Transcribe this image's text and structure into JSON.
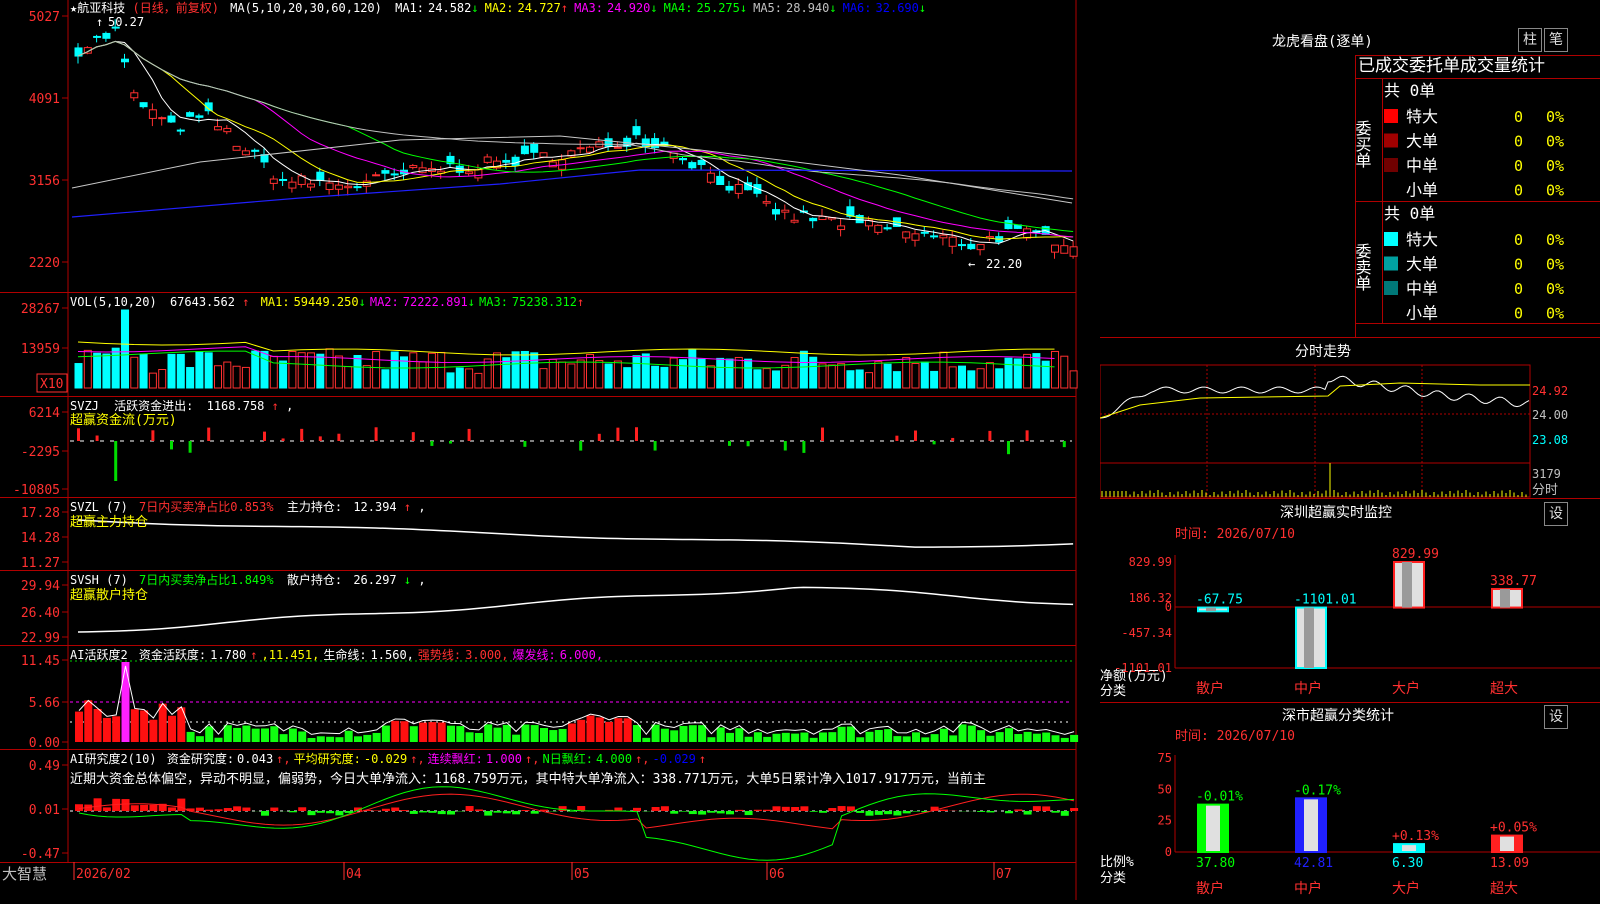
{
  "header": {
    "stock_name": "★航亚科技",
    "mode": "(日线，前复权)",
    "ma_params": "MA(5,10,20,30,60,120)",
    "ma": [
      {
        "label": "MA1:",
        "value": "24.582",
        "arrow": "↓",
        "color": "#ffffff"
      },
      {
        "label": "MA2:",
        "value": "24.727",
        "arrow": "↑",
        "color": "#ffff00"
      },
      {
        "label": "MA3:",
        "value": "24.920",
        "arrow": "↓",
        "color": "#ff00ff"
      },
      {
        "label": "MA4:",
        "value": "25.275",
        "arrow": "↓",
        "color": "#00ff00"
      },
      {
        "label": "MA5:",
        "value": "28.940",
        "arrow": "↓",
        "color": "#c0c0c0"
      },
      {
        "label": "MA6:",
        "value": "32.690",
        "arrow": "↓",
        "color": "#0000ff"
      }
    ]
  },
  "price_axis": [
    "5027",
    "4091",
    "3156",
    "2220"
  ],
  "price_marks": {
    "high": "50.27",
    "low": "22.20"
  },
  "vol_panel": {
    "title": "VOL(5,10,20)",
    "value": "67643.562",
    "value_arrow": "↑",
    "ma": [
      {
        "label": "MA1:",
        "value": "59449.250",
        "arrow": "↓",
        "color": "#ffff00"
      },
      {
        "label": "MA2:",
        "value": "72222.891",
        "arrow": "↓",
        "color": "#ff00ff"
      },
      {
        "label": "MA3:",
        "value": "75238.312",
        "arrow": "↑",
        "color": "#00ff00"
      }
    ],
    "axis": [
      "28267",
      "13959"
    ],
    "unit": "X10"
  },
  "svzj_panel": {
    "title": "SVZJ",
    "label": "活跃资金进出:",
    "value": "1168.758",
    "arrow": "↑",
    "suffix": ",",
    "subtitle": "超赢资金流(万元)",
    "axis": [
      "6214",
      "-2295",
      "-10805"
    ]
  },
  "svzl_panel": {
    "title": "SVZL (7)",
    "pct_label": "7日内买卖净占比0.853%",
    "hold_label": "主力持仓:",
    "hold_value": "12.394",
    "arrow": "↑",
    "suffix": ",",
    "subtitle": "超赢主力持仓",
    "axis": [
      "17.28",
      "14.28",
      "11.27"
    ]
  },
  "svsh_panel": {
    "title": "SVSH (7)",
    "pct_label": "7日内买卖净占比1.849%",
    "hold_label": "散户持仓:",
    "hold_value": "26.297",
    "arrow": "↓",
    "suffix": ",",
    "subtitle": "超赢散户持仓",
    "axis": [
      "29.94",
      "26.40",
      "22.99"
    ]
  },
  "ai2_panel": {
    "title": "AI活跃度2",
    "items": [
      {
        "text": "资金活跃度:",
        "color": "#ffffff"
      },
      {
        "text": "1.780",
        "color": "#ffffff"
      },
      {
        "text": "↑",
        "color": "#ff3030"
      },
      {
        "text": ",11.451,",
        "color": "#ffff00"
      },
      {
        "text": "生命线:",
        "color": "#ffffff"
      },
      {
        "text": "1.560,",
        "color": "#ffffff"
      },
      {
        "text": "强势线:",
        "color": "#ff3030"
      },
      {
        "text": "3.000,",
        "color": "#ff3030"
      },
      {
        "text": "爆发线:",
        "color": "#ff00ff"
      },
      {
        "text": "6.000,",
        "color": "#ff00ff"
      }
    ],
    "axis": [
      "11.45",
      "5.66",
      "0.00"
    ]
  },
  "ai_research_panel": {
    "title": "AI研究度2(10)",
    "items": [
      {
        "text": "资金研究度:",
        "color": "#ffffff"
      },
      {
        "text": "0.043",
        "color": "#ffffff"
      },
      {
        "text": "↑,",
        "color": "#ff3030"
      },
      {
        "text": "平均研究度:",
        "color": "#ffff00"
      },
      {
        "text": "-0.029",
        "color": "#ffff00"
      },
      {
        "text": "↑,",
        "color": "#ff3030"
      },
      {
        "text": "连续飘红:",
        "color": "#ff00ff"
      },
      {
        "text": "1.000",
        "color": "#ff00ff"
      },
      {
        "text": "↑,",
        "color": "#ff3030"
      },
      {
        "text": "N日飘红:",
        "color": "#00ff00"
      },
      {
        "text": "4.000",
        "color": "#00ff00"
      },
      {
        "text": "↑,",
        "color": "#ff3030"
      },
      {
        "text": "-0.029",
        "color": "#0000ff"
      },
      {
        "text": "↑",
        "color": "#ff3030"
      }
    ],
    "commentary": "近期大资金总体偏空，异动不明显，偏弱势，今日大单净流入：1168.759万元，其中特大单净流入：338.771万元，大单5日累计净入1017.917万元，当前主",
    "axis": [
      "0.49",
      "0.01",
      "-0.47"
    ]
  },
  "time_axis": {
    "brand": "大智慧",
    "labels": [
      "2026/02",
      "04",
      "05",
      "06",
      "07"
    ]
  },
  "dragon": {
    "title": "龙虎看盘(逐单)",
    "btn_bar": "柱",
    "btn_stroke": "笔",
    "subtitle": "已成交委托单成交量统计",
    "buy": {
      "label": "委买单",
      "total": "共 0单",
      "rows": [
        {
          "name": "特大",
          "count": "0",
          "pct": "0%",
          "color": "#ff0000"
        },
        {
          "name": "大单",
          "count": "0",
          "pct": "0%",
          "color": "#a00000"
        },
        {
          "name": "中单",
          "count": "0",
          "pct": "0%",
          "color": "#700000"
        },
        {
          "name": "小单",
          "count": "0",
          "pct": "0%",
          "color": ""
        }
      ]
    },
    "sell": {
      "label": "委卖单",
      "total": "共 0单",
      "rows": [
        {
          "name": "特大",
          "count": "0",
          "pct": "0%",
          "color": "#00ffff"
        },
        {
          "name": "大单",
          "count": "0",
          "pct": "0%",
          "color": "#00a0a0"
        },
        {
          "name": "中单",
          "count": "0",
          "pct": "0%",
          "color": "#007878"
        },
        {
          "name": "小单",
          "count": "0",
          "pct": "0%",
          "color": ""
        }
      ]
    }
  },
  "intraday": {
    "title": "分时走势",
    "price_axis": [
      "24.92",
      "24.00",
      "23.08"
    ],
    "vol_axis": "3179",
    "vol_label": "分时"
  },
  "sz_monitor": {
    "title": "深圳超赢实时监控",
    "btn": "设",
    "time": "时间: 2026/07/10",
    "axis": [
      "829.99",
      "186.32",
      "0",
      "-457.34",
      "-1101.01"
    ],
    "ylabel": "净额(万元)",
    "xlabel": "分类",
    "categories": [
      "散户",
      "中户",
      "大户",
      "超大"
    ],
    "value_labels": [
      "-67.75",
      "-1101.01",
      "829.99",
      "338.77"
    ]
  },
  "sz_class": {
    "title": "深市超赢分类统计",
    "btn": "设",
    "time": "时间: 2026/07/10",
    "axis": [
      "75",
      "50",
      "25",
      "0"
    ],
    "ylabel": "比例%",
    "xlabel": "分类",
    "categories": [
      "散户",
      "中户",
      "大户",
      "超大"
    ],
    "change_labels": [
      "-0.01%",
      "-0.17%",
      "+0.13%",
      "+0.05%"
    ],
    "value_labels": [
      "37.80",
      "42.81",
      "6.30",
      "13.09"
    ]
  },
  "chart_data": [
    {
      "type": "bar",
      "title": "深圳超赢实时监控",
      "ylabel": "净额(万元)",
      "xlabel": "分类",
      "categories": [
        "散户",
        "中户",
        "大户",
        "超大"
      ],
      "values": [
        -67.75,
        -1101.01,
        829.99,
        338.77
      ],
      "ylim": [
        -1101.01,
        829.99
      ]
    },
    {
      "type": "bar",
      "title": "深市超赢分类统计",
      "ylabel": "比例%",
      "xlabel": "分类",
      "categories": [
        "散户",
        "中户",
        "大户",
        "超大"
      ],
      "values": [
        37.8,
        42.81,
        6.3,
        13.09
      ],
      "ylim": [
        0,
        75
      ]
    },
    {
      "type": "line",
      "title": "航亚科技",
      "x": [
        "2026/02",
        "04",
        "05",
        "06",
        "07"
      ],
      "series": [
        {
          "name": "close",
          "values": [
            46.5,
            38.0,
            40.5,
            31.0,
            32.0,
            33.0,
            35.5,
            30.5,
            27.0,
            25.5,
            24.6
          ]
        }
      ],
      "ylim": [
        22.2,
        50.27
      ]
    }
  ]
}
